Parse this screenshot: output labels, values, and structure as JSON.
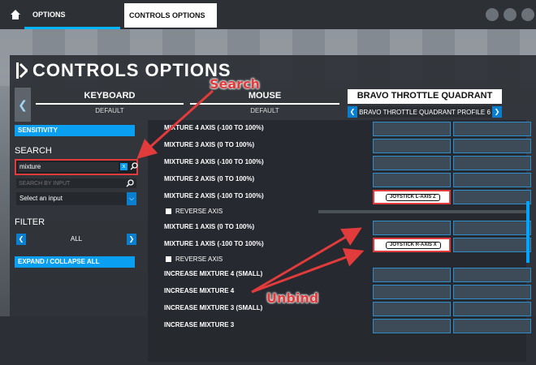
{
  "topbar": {
    "tab_options": "OPTIONS",
    "tab_controls": "CONTROLS OPTIONS"
  },
  "panel": {
    "title": "CONTROLS OPTIONS"
  },
  "devices": [
    {
      "name": "KEYBOARD",
      "profile": "DEFAULT"
    },
    {
      "name": "MOUSE",
      "profile": "DEFAULT"
    },
    {
      "name": "BRAVO THROTTLE QUADRANT",
      "profile": "BRAVO THROTTLE QUADRANT PROFILE 6"
    }
  ],
  "sidebar": {
    "sensitivity": "SENSITIVITY",
    "search_label": "SEARCH",
    "search_value": "mixture",
    "search_clear": "x",
    "search_by_input_placeholder": "SEARCH BY INPUT",
    "select_input": "Select an input",
    "filter_label": "FILTER",
    "filter_value": "ALL",
    "expand_collapse": "EXPAND / COLLAPSE ALL"
  },
  "bindings": [
    {
      "label": "MIXTURE 4 AXIS (-100 TO 100%)",
      "slot1": ""
    },
    {
      "label": "MIXTURE 3 AXIS (0 TO 100%)",
      "slot1": ""
    },
    {
      "label": "MIXTURE 3 AXIS (-100 TO 100%)",
      "slot1": ""
    },
    {
      "label": "MIXTURE 2 AXIS (0 TO 100%)",
      "slot1": ""
    },
    {
      "label": "MIXTURE 2 AXIS (-100 TO 100%)",
      "slot1": "JOYSTICK L-AXIS Z"
    },
    {
      "label": "MIXTURE 1 AXIS (0 TO 100%)",
      "slot1": ""
    },
    {
      "label": "MIXTURE 1 AXIS (-100 TO 100%)",
      "slot1": "JOYSTICK R-AXIS X"
    },
    {
      "label": "INCREASE MIXTURE 4 (SMALL)",
      "slot1": ""
    },
    {
      "label": "INCREASE MIXTURE 4",
      "slot1": ""
    },
    {
      "label": "INCREASE MIXTURE 3 (SMALL)",
      "slot1": ""
    },
    {
      "label": "INCREASE MIXTURE 3",
      "slot1": ""
    }
  ],
  "reverse_axis": "REVERSE AXIS",
  "annotations": {
    "search": "Search",
    "unbind": "Unbind"
  },
  "colors": {
    "accent": "#0a9ff0",
    "annotation": "#e23b3b"
  }
}
